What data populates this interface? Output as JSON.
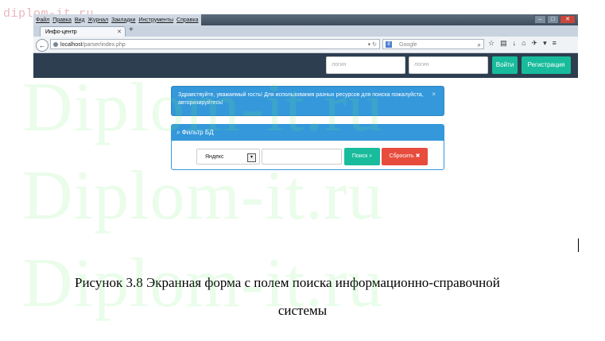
{
  "watermark": {
    "small": "diplom-it.ru",
    "big": "Diplom-it.ru"
  },
  "browser": {
    "menu": [
      "Файл",
      "Правка",
      "Вид",
      "Журнал",
      "Закладки",
      "Инструменты",
      "Справка"
    ],
    "tab_title": "Инфо-центр",
    "url_host": "localhost",
    "url_path": "/parser/index.php",
    "search_placeholder": "Google"
  },
  "app": {
    "login_placeholder_1": "логин",
    "login_placeholder_2": "логин",
    "login_button": "Войти",
    "register_button": "Регистрация"
  },
  "alert": {
    "text": "Здравствуйте, уважаемый гость! Для использования разных ресурсов для поиска пожалуйста, авторизируйтесь!",
    "close": "×"
  },
  "filter": {
    "title": "Фильтр БД",
    "select_value": "Яндекс",
    "search_button": "Поиск",
    "reset_button": "Сбросить"
  },
  "caption": {
    "line1": "Рисунок 3.8 Экранная форма с полем поиска информационно-справочной",
    "line2": "системы"
  }
}
